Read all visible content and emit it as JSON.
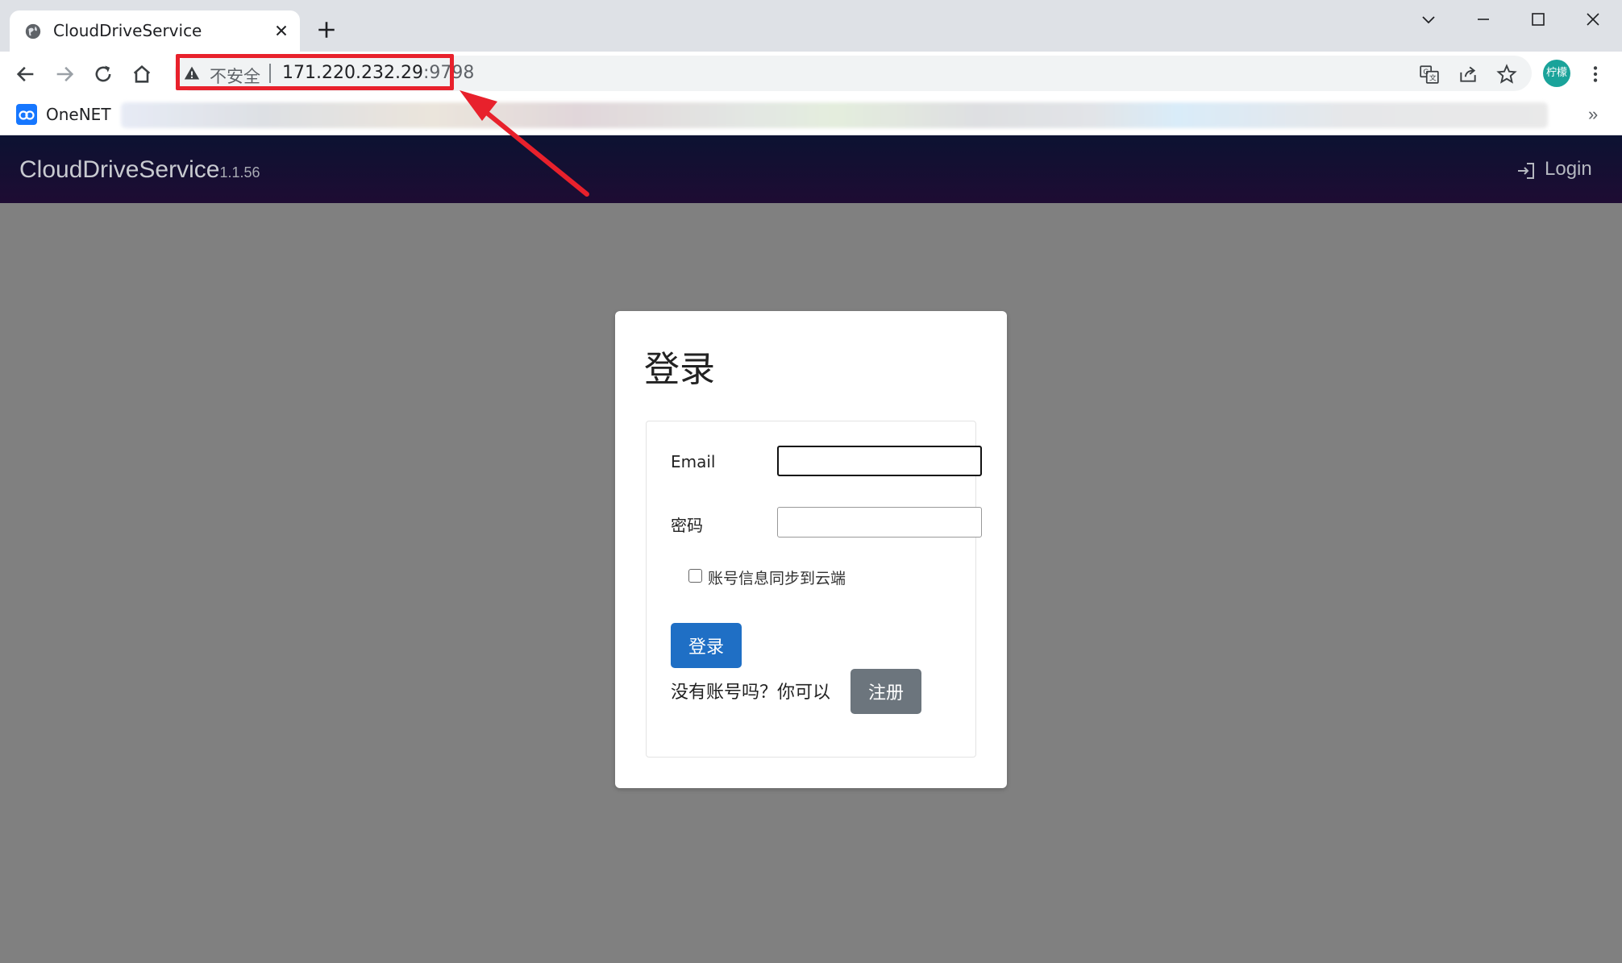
{
  "browser": {
    "tab_title": "CloudDriveService",
    "omnibox": {
      "security_label": "不安全",
      "url_host": "171.220.232.29",
      "url_port": ":9798"
    },
    "avatar_text": "柠檬",
    "bookmarks": [
      {
        "label": "OneNET",
        "icon": "onenet-icon"
      }
    ],
    "bookmarks_more": "»"
  },
  "navbar": {
    "brand": "CloudDriveService",
    "version": "1.1.56",
    "login_label": "Login"
  },
  "login_card": {
    "title": "登录",
    "email_label": "Email",
    "email_value": "",
    "password_label": "密码",
    "password_value": "",
    "sync_label": "账号信息同步到云端",
    "sync_checked": false,
    "submit_label": "登录",
    "register_prompt": "没有账号吗？你可以",
    "register_label": "注册"
  },
  "annotation": {
    "color": "#e8212c"
  }
}
